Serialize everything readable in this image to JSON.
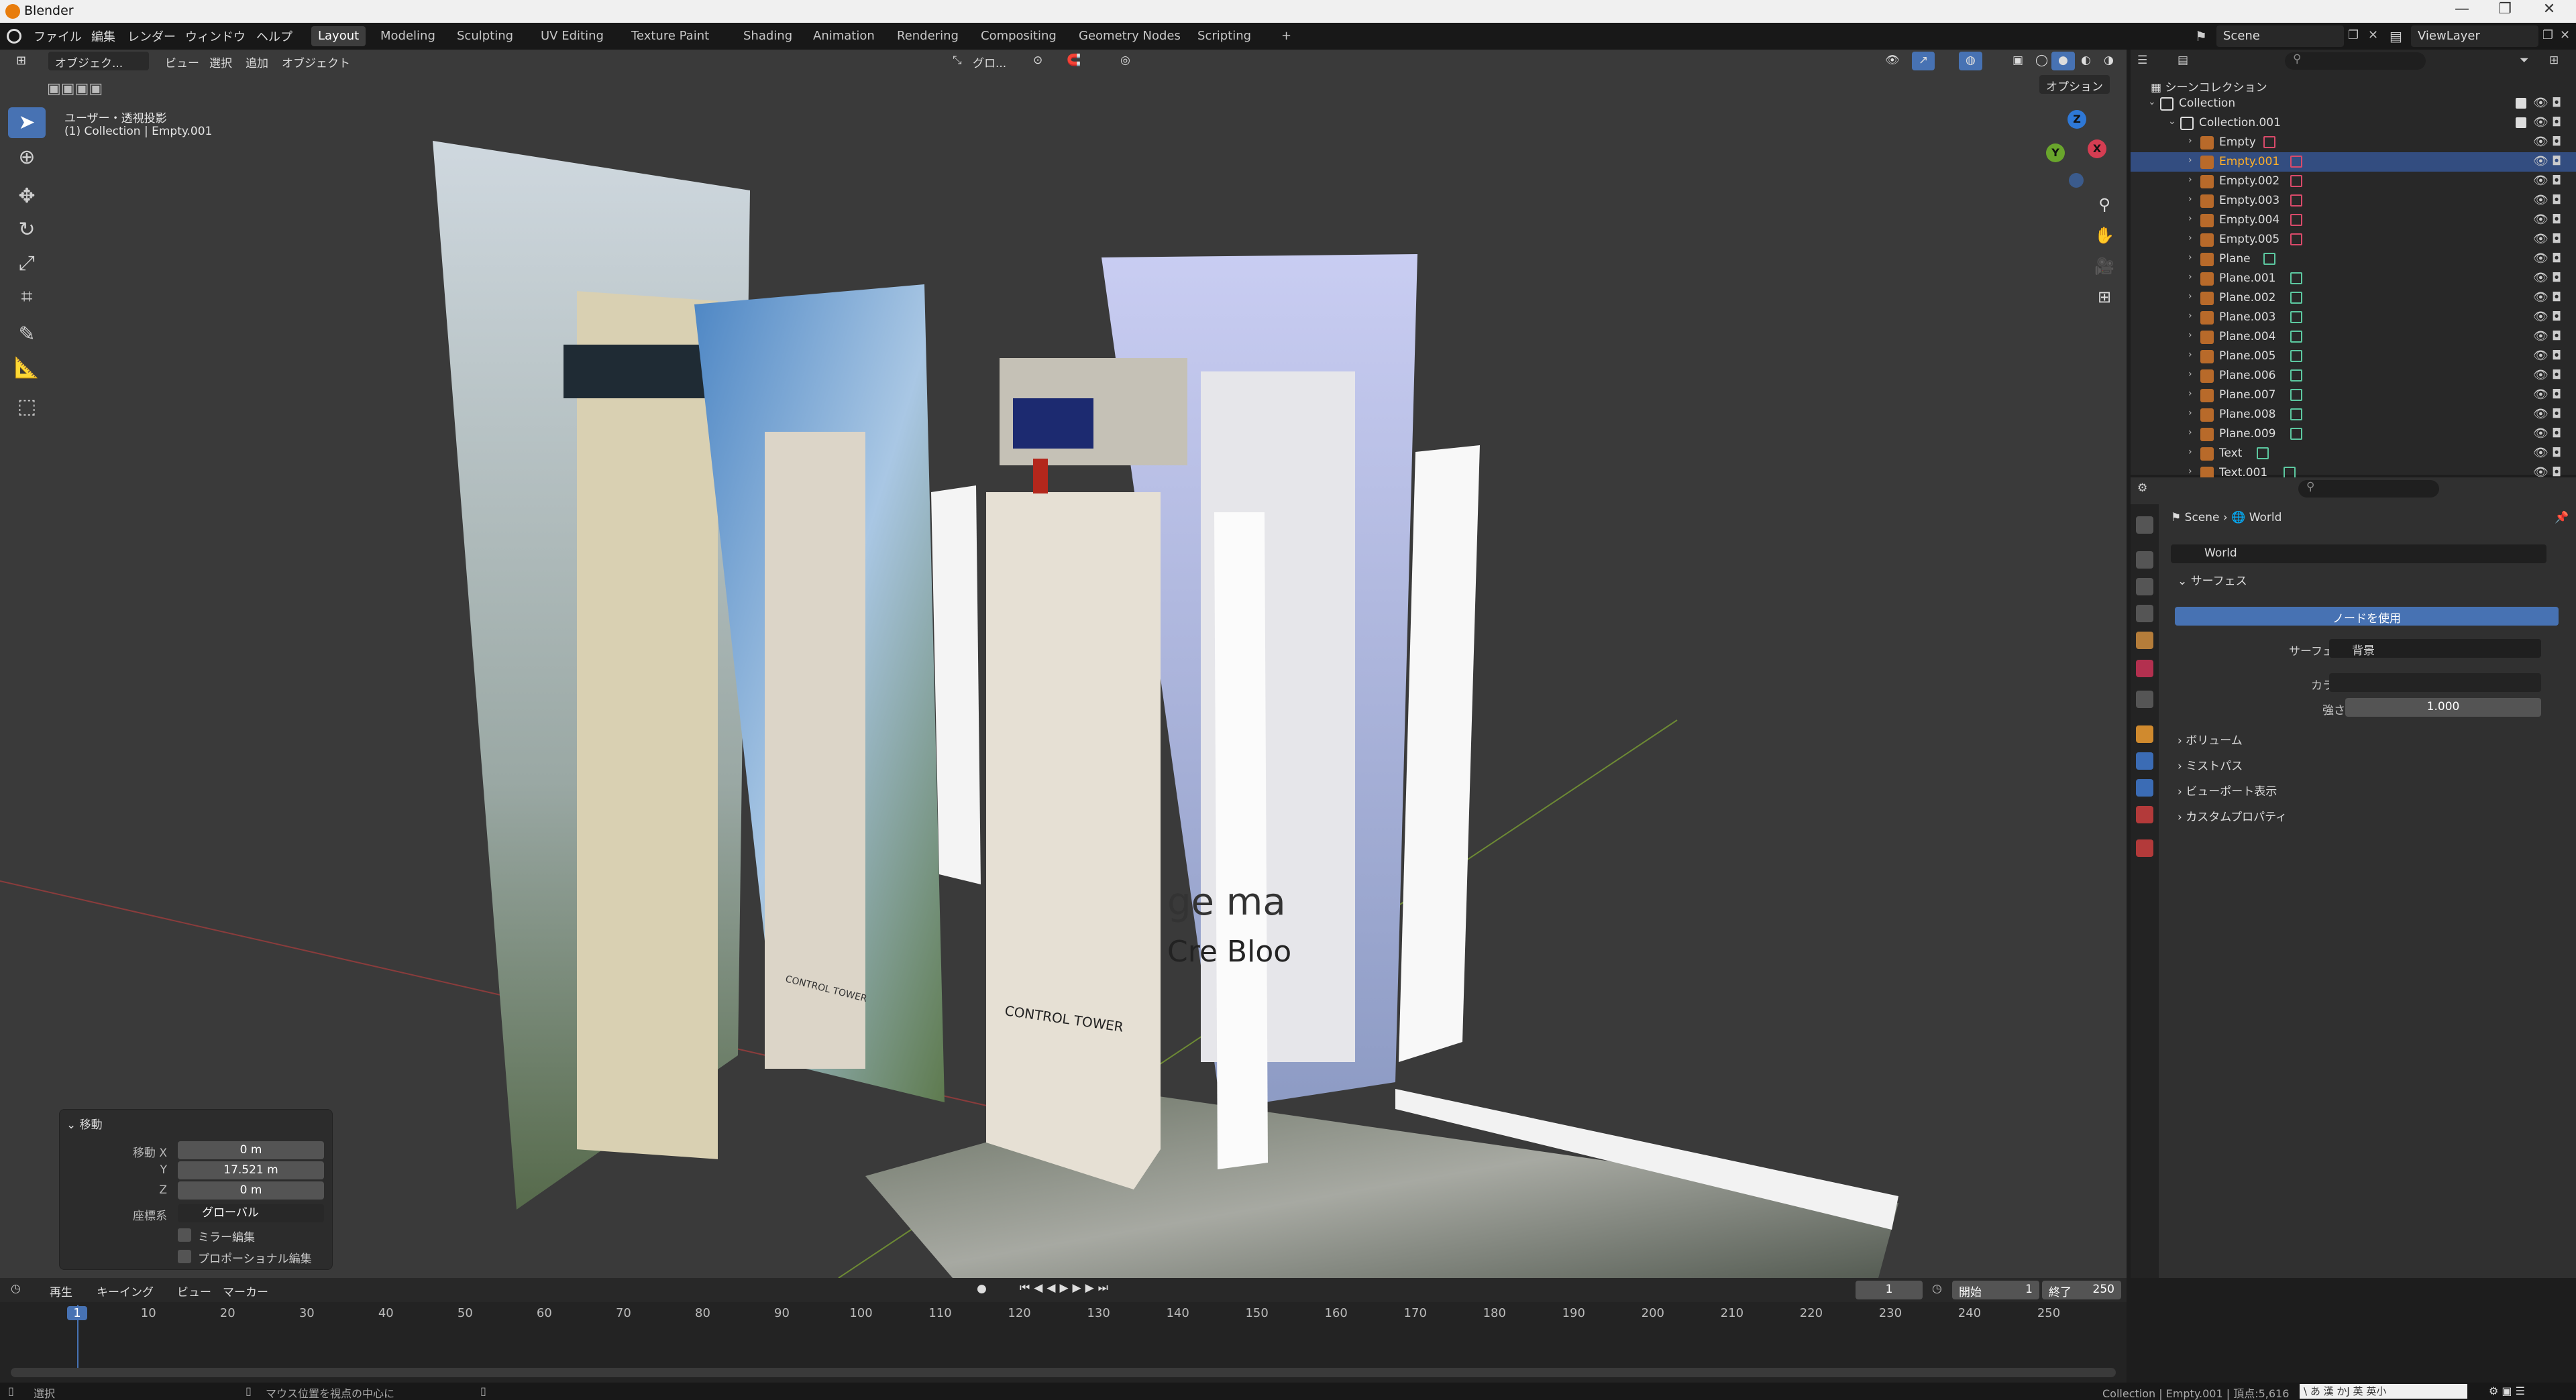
{
  "window": {
    "title": "Blender",
    "controls": [
      "—",
      "❐",
      "✕"
    ]
  },
  "menus": [
    "ファイル",
    "編集",
    "レンダー",
    "ウィンドウ",
    "ヘルプ"
  ],
  "workspaces": [
    {
      "label": "Layout",
      "active": true
    },
    {
      "label": "Modeling"
    },
    {
      "label": "Sculpting"
    },
    {
      "label": "UV Editing"
    },
    {
      "label": "Texture Paint"
    },
    {
      "label": "Shading"
    },
    {
      "label": "Animation"
    },
    {
      "label": "Rendering"
    },
    {
      "label": "Compositing"
    },
    {
      "label": "Geometry Nodes"
    },
    {
      "label": "Scripting"
    },
    {
      "label": "+"
    }
  ],
  "scene": {
    "name": "Scene",
    "view_layer": "ViewLayer"
  },
  "viewport": {
    "mode": "オブジェク...",
    "menus": [
      "ビュー",
      "選択",
      "追加",
      "オブジェクト"
    ],
    "transform": "グロ...",
    "options": "オプション",
    "overlay_line1": "ユーザー・透視投影",
    "overlay_line2": "(1) Collection | Empty.001",
    "gizmo": {
      "x": "X",
      "y": "Y",
      "z": "Z"
    },
    "tools": [
      "select-box",
      "cursor",
      "move",
      "rotate",
      "scale",
      "transform",
      "annotate",
      "measure",
      "add-cube"
    ],
    "scene_labels": {
      "tower1": "CONTROL TOWER",
      "tower2": "CONTROL TOWER",
      "mirror1": "ge ma",
      "mirror2": "Cre Bloo"
    }
  },
  "operator": {
    "title": "移動",
    "rows": [
      {
        "label": "移動 X",
        "value": "0 m"
      },
      {
        "label": "Y",
        "value": "17.521 m"
      },
      {
        "label": "Z",
        "value": "0 m"
      }
    ],
    "orient_label": "座標系",
    "orient_value": "グローバル",
    "mirror": "ミラー編集",
    "proportional": "プロポーショナル編集"
  },
  "outliner": {
    "root": "シーンコレクション",
    "items": [
      {
        "label": "Collection",
        "depth": 0,
        "kind": "collection"
      },
      {
        "label": "Collection.001",
        "depth": 1,
        "kind": "collection"
      },
      {
        "label": "Empty",
        "depth": 2,
        "kind": "empty"
      },
      {
        "label": "Empty.001",
        "depth": 2,
        "kind": "empty",
        "selected": true
      },
      {
        "label": "Empty.002",
        "depth": 2,
        "kind": "empty"
      },
      {
        "label": "Empty.003",
        "depth": 2,
        "kind": "empty"
      },
      {
        "label": "Empty.004",
        "depth": 2,
        "kind": "empty"
      },
      {
        "label": "Empty.005",
        "depth": 2,
        "kind": "empty"
      },
      {
        "label": "Plane",
        "depth": 2,
        "kind": "mesh"
      },
      {
        "label": "Plane.001",
        "depth": 2,
        "kind": "mesh"
      },
      {
        "label": "Plane.002",
        "depth": 2,
        "kind": "mesh"
      },
      {
        "label": "Plane.003",
        "depth": 2,
        "kind": "mesh"
      },
      {
        "label": "Plane.004",
        "depth": 2,
        "kind": "mesh"
      },
      {
        "label": "Plane.005",
        "depth": 2,
        "kind": "mesh"
      },
      {
        "label": "Plane.006",
        "depth": 2,
        "kind": "mesh"
      },
      {
        "label": "Plane.007",
        "depth": 2,
        "kind": "mesh"
      },
      {
        "label": "Plane.008",
        "depth": 2,
        "kind": "mesh"
      },
      {
        "label": "Plane.009",
        "depth": 2,
        "kind": "mesh"
      },
      {
        "label": "Text",
        "depth": 2,
        "kind": "text"
      },
      {
        "label": "Text.001",
        "depth": 2,
        "kind": "text"
      }
    ]
  },
  "properties": {
    "breadcrumb_scene": "Scene",
    "breadcrumb_world": "World",
    "world_name": "World",
    "surface_section": "サーフェス",
    "use_nodes": "ノードを使用",
    "surface_label": "サーフェス",
    "surface_value": "背景",
    "color_label": "カラー",
    "strength_label": "強さ",
    "strength_value": "1.000",
    "collapsed": [
      "ボリューム",
      "ミストパス",
      "ビューポート表示",
      "カスタムプロパティ"
    ]
  },
  "timeline": {
    "menus": [
      "再生",
      "キーイング",
      "ビュー",
      "マーカー"
    ],
    "current_frame": "1",
    "start_label": "開始",
    "start": "1",
    "end_label": "終了",
    "end": "250",
    "ticks": [
      "1",
      "10",
      "20",
      "30",
      "40",
      "50",
      "60",
      "70",
      "80",
      "90",
      "100",
      "110",
      "120",
      "130",
      "140",
      "150",
      "160",
      "170",
      "180",
      "190",
      "200",
      "210",
      "220",
      "230",
      "240",
      "250"
    ]
  },
  "status": {
    "select": "選択",
    "center": "マウス位置を視点の中心に",
    "info": "Collection | Empty.001 | 頂点:5,616",
    "ime": "\\ あ 漢 かJ 英 英小"
  }
}
